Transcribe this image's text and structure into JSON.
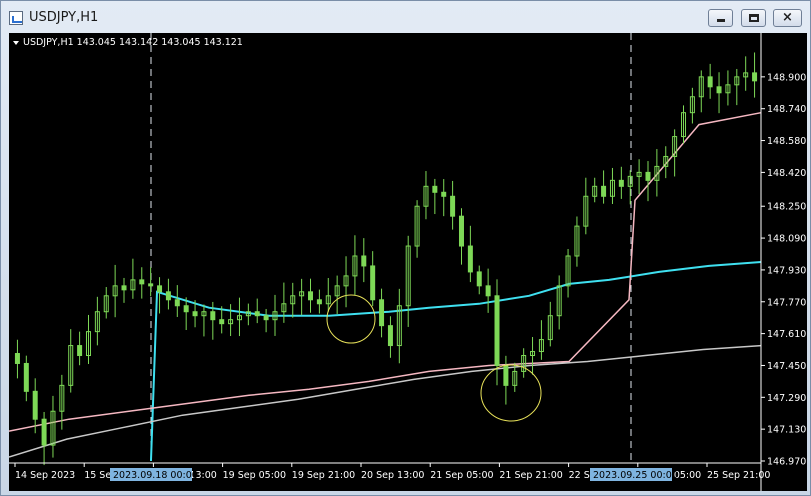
{
  "window": {
    "title": "USDJPY,H1",
    "minimize_label": "",
    "maximize_label": "",
    "close_label": "×"
  },
  "chart_data": {
    "type": "candlestick",
    "symbol": "USDJPY,H1",
    "header_text": "USDJPY,H1  143.045 143.142 143.045 143.121",
    "ylim": [
      146.97,
      149.05
    ],
    "y_ticks": [
      "148.900",
      "148.740",
      "148.580",
      "148.420",
      "148.250",
      "148.090",
      "147.930",
      "147.770",
      "147.610",
      "147.450",
      "147.290",
      "147.130",
      "146.970"
    ],
    "x_ticks": [
      "14 Sep 2023",
      "15 Sep 0",
      "18 Sep 13:00",
      "19 Sep 05:00",
      "19 Sep 21:00",
      "20 Sep 13:00",
      "21 Sep 05:00",
      "21 Sep 21:00",
      "22 Sep",
      "25 Sep 05:00",
      "25 Sep 21:00"
    ],
    "highlighted_dates": [
      "2023.09.18 00:00",
      "2023.09.25 00:00"
    ],
    "colors": {
      "background": "#000000",
      "candles": "#7ed957",
      "ma_cyan": "#3fe0f0",
      "ma_pink": "#f6b8c2",
      "ma_gray": "#c8c8c8",
      "circle": "#e8e25a",
      "highlight_bg": "#7fb4e0"
    },
    "series": [
      {
        "name": "",
        "role": "close",
        "values": [
          147.46,
          147.32,
          147.18,
          147.05,
          147.22,
          147.35,
          147.55,
          147.5,
          147.62,
          147.72,
          147.8,
          147.85,
          147.83,
          147.88,
          147.86,
          147.85,
          147.82,
          147.78,
          147.75,
          147.72,
          147.7,
          147.72,
          147.68,
          147.66,
          147.68,
          147.7,
          147.72,
          147.7,
          147.68,
          147.72,
          147.76,
          147.8,
          147.82,
          147.78,
          147.76,
          147.8,
          147.85,
          147.9,
          148.0,
          147.95,
          147.78,
          147.65,
          147.55,
          147.75,
          148.05,
          148.25,
          148.35,
          148.32,
          148.3,
          148.2,
          148.05,
          147.92,
          147.85,
          147.8,
          147.45,
          147.35,
          147.42,
          147.5,
          147.52,
          147.58,
          147.7,
          147.85,
          148.0,
          148.15,
          148.3,
          148.35,
          148.3,
          148.38,
          148.35,
          148.4,
          148.42,
          148.38,
          148.45,
          148.5,
          148.6,
          148.72,
          148.8,
          148.9,
          148.85,
          148.82,
          148.86,
          148.9,
          148.92,
          148.88
        ]
      },
      {
        "name": "",
        "role": "ma-cyan",
        "values": [
          146.975,
          146.975,
          146.975,
          146.975,
          147.82,
          147.74,
          147.7,
          147.7,
          147.72,
          147.74,
          147.76,
          147.8,
          147.86,
          147.88,
          147.92,
          147.95,
          147.97
        ]
      },
      {
        "name": "",
        "role": "ma-pink",
        "values": [
          147.12,
          147.18,
          147.22,
          147.26,
          147.3,
          147.33,
          147.37,
          147.42,
          147.45,
          147.47,
          147.78,
          148.28,
          148.66,
          148.72
        ]
      },
      {
        "name": "",
        "role": "ma-gray",
        "values": [
          146.99,
          147.08,
          147.14,
          147.2,
          147.24,
          147.28,
          147.33,
          147.38,
          147.42,
          147.45,
          147.47,
          147.5,
          147.53,
          147.55
        ]
      }
    ]
  }
}
